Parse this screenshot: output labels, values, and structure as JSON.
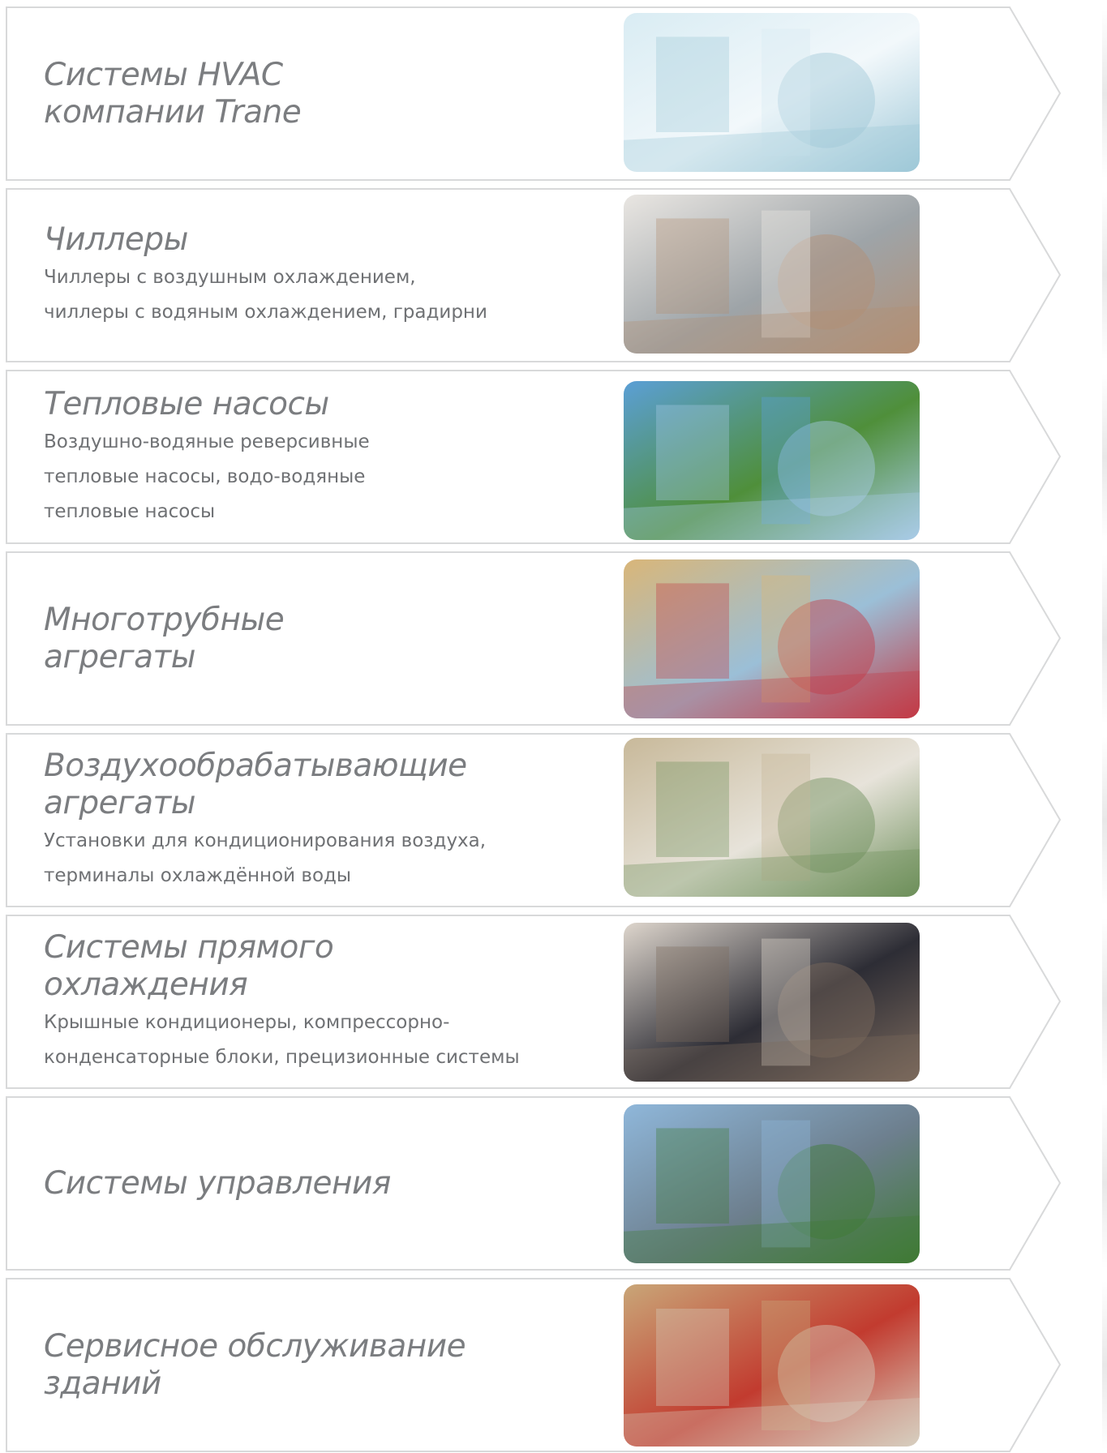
{
  "items": [
    {
      "title": "Системы HVAC\nкомпании Trane",
      "desc": "",
      "image": "blueprint-building-model-photo",
      "colors": [
        "#d9ecf3",
        "#9fc8d8",
        "#f2f8fb"
      ]
    },
    {
      "title": "Чиллеры",
      "desc": "Чиллеры с воздушным охлаждением,\nчиллеры с водяным охлаждением, градирни",
      "image": "man-with-building-model-photo",
      "colors": [
        "#e9e6e2",
        "#b38f74",
        "#9ea4a8"
      ]
    },
    {
      "title": "Тепловые насосы",
      "desc": "Воздушно-водяные реверсивные\nтепловые насосы, водо-водяные\nтепловые насосы",
      "image": "glass-building-with-tree-photo",
      "colors": [
        "#5b9fd6",
        "#a9cbe7",
        "#4f8f3a"
      ]
    },
    {
      "title": "Многотрубные\nагрегаты",
      "desc": "",
      "image": "family-with-luggage-hotel-photo",
      "colors": [
        "#d9b679",
        "#c33a46",
        "#9bbfd7"
      ]
    },
    {
      "title": "Воздухообрабатывающие\nагрегаты",
      "desc": "Установки для кондиционирования воздуха,\nтерминалы охлаждённой воды",
      "image": "atrium-garden-photo",
      "colors": [
        "#c8b99a",
        "#6d8f5a",
        "#e7e3da"
      ]
    },
    {
      "title": "Системы прямого\nохлаждения",
      "desc": "Крышные кондиционеры, компрессорно-\nконденсаторные блоки, прецизионные системы",
      "image": "clothing-store-woman-photo",
      "colors": [
        "#ded6cd",
        "#7c6a5d",
        "#2d2d35"
      ]
    },
    {
      "title": "Системы управления",
      "desc": "",
      "image": "city-skyline-park-photo",
      "colors": [
        "#8fb7da",
        "#3f7a34",
        "#6d7f8e"
      ]
    },
    {
      "title": "Сервисное обслуживание\nзданий",
      "desc": "",
      "image": "service-technician-photo",
      "colors": [
        "#c9a678",
        "#d7cfbf",
        "#c23b2f"
      ]
    }
  ]
}
